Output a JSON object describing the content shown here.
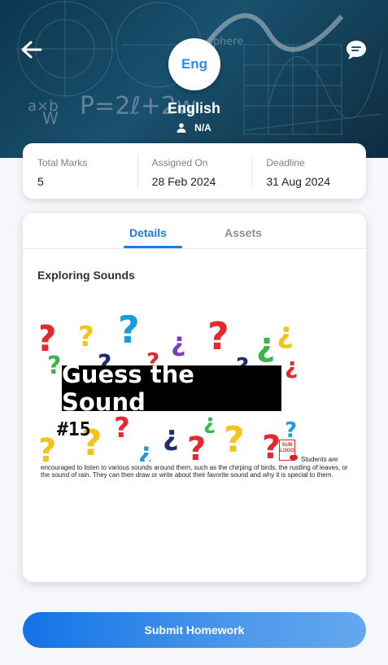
{
  "header": {
    "subject_code": "Eng",
    "subject_name": "English",
    "teacher": "N/A",
    "background_text": [
      "P=2ℓ+2w",
      "a×b",
      "W",
      "sphere"
    ]
  },
  "stats": [
    {
      "label": "Total Marks",
      "value": "5"
    },
    {
      "label": "Assigned On",
      "value": "28 Feb 2024"
    },
    {
      "label": "Deadline",
      "value": "31 Aug 2024"
    }
  ],
  "tabs": {
    "details": "Details",
    "assets": "Assets"
  },
  "homework": {
    "title": "Exploring Sounds",
    "image": {
      "title": "Guess the Sound",
      "number": "#15",
      "stamp": "SUB LOGO"
    },
    "description": "Students are encouraged to listen to various sounds around them, such as the chirping of birds, the rustling of leaves, or the sound of rain. They can then draw or write about their favorite sound and why it is special to them."
  },
  "actions": {
    "submit_label": "Submit Homework"
  },
  "colors": {
    "accent": "#1a7be0",
    "header_bg": "#17465f",
    "button_start": "#1273e6",
    "button_end": "#64a8ee"
  }
}
